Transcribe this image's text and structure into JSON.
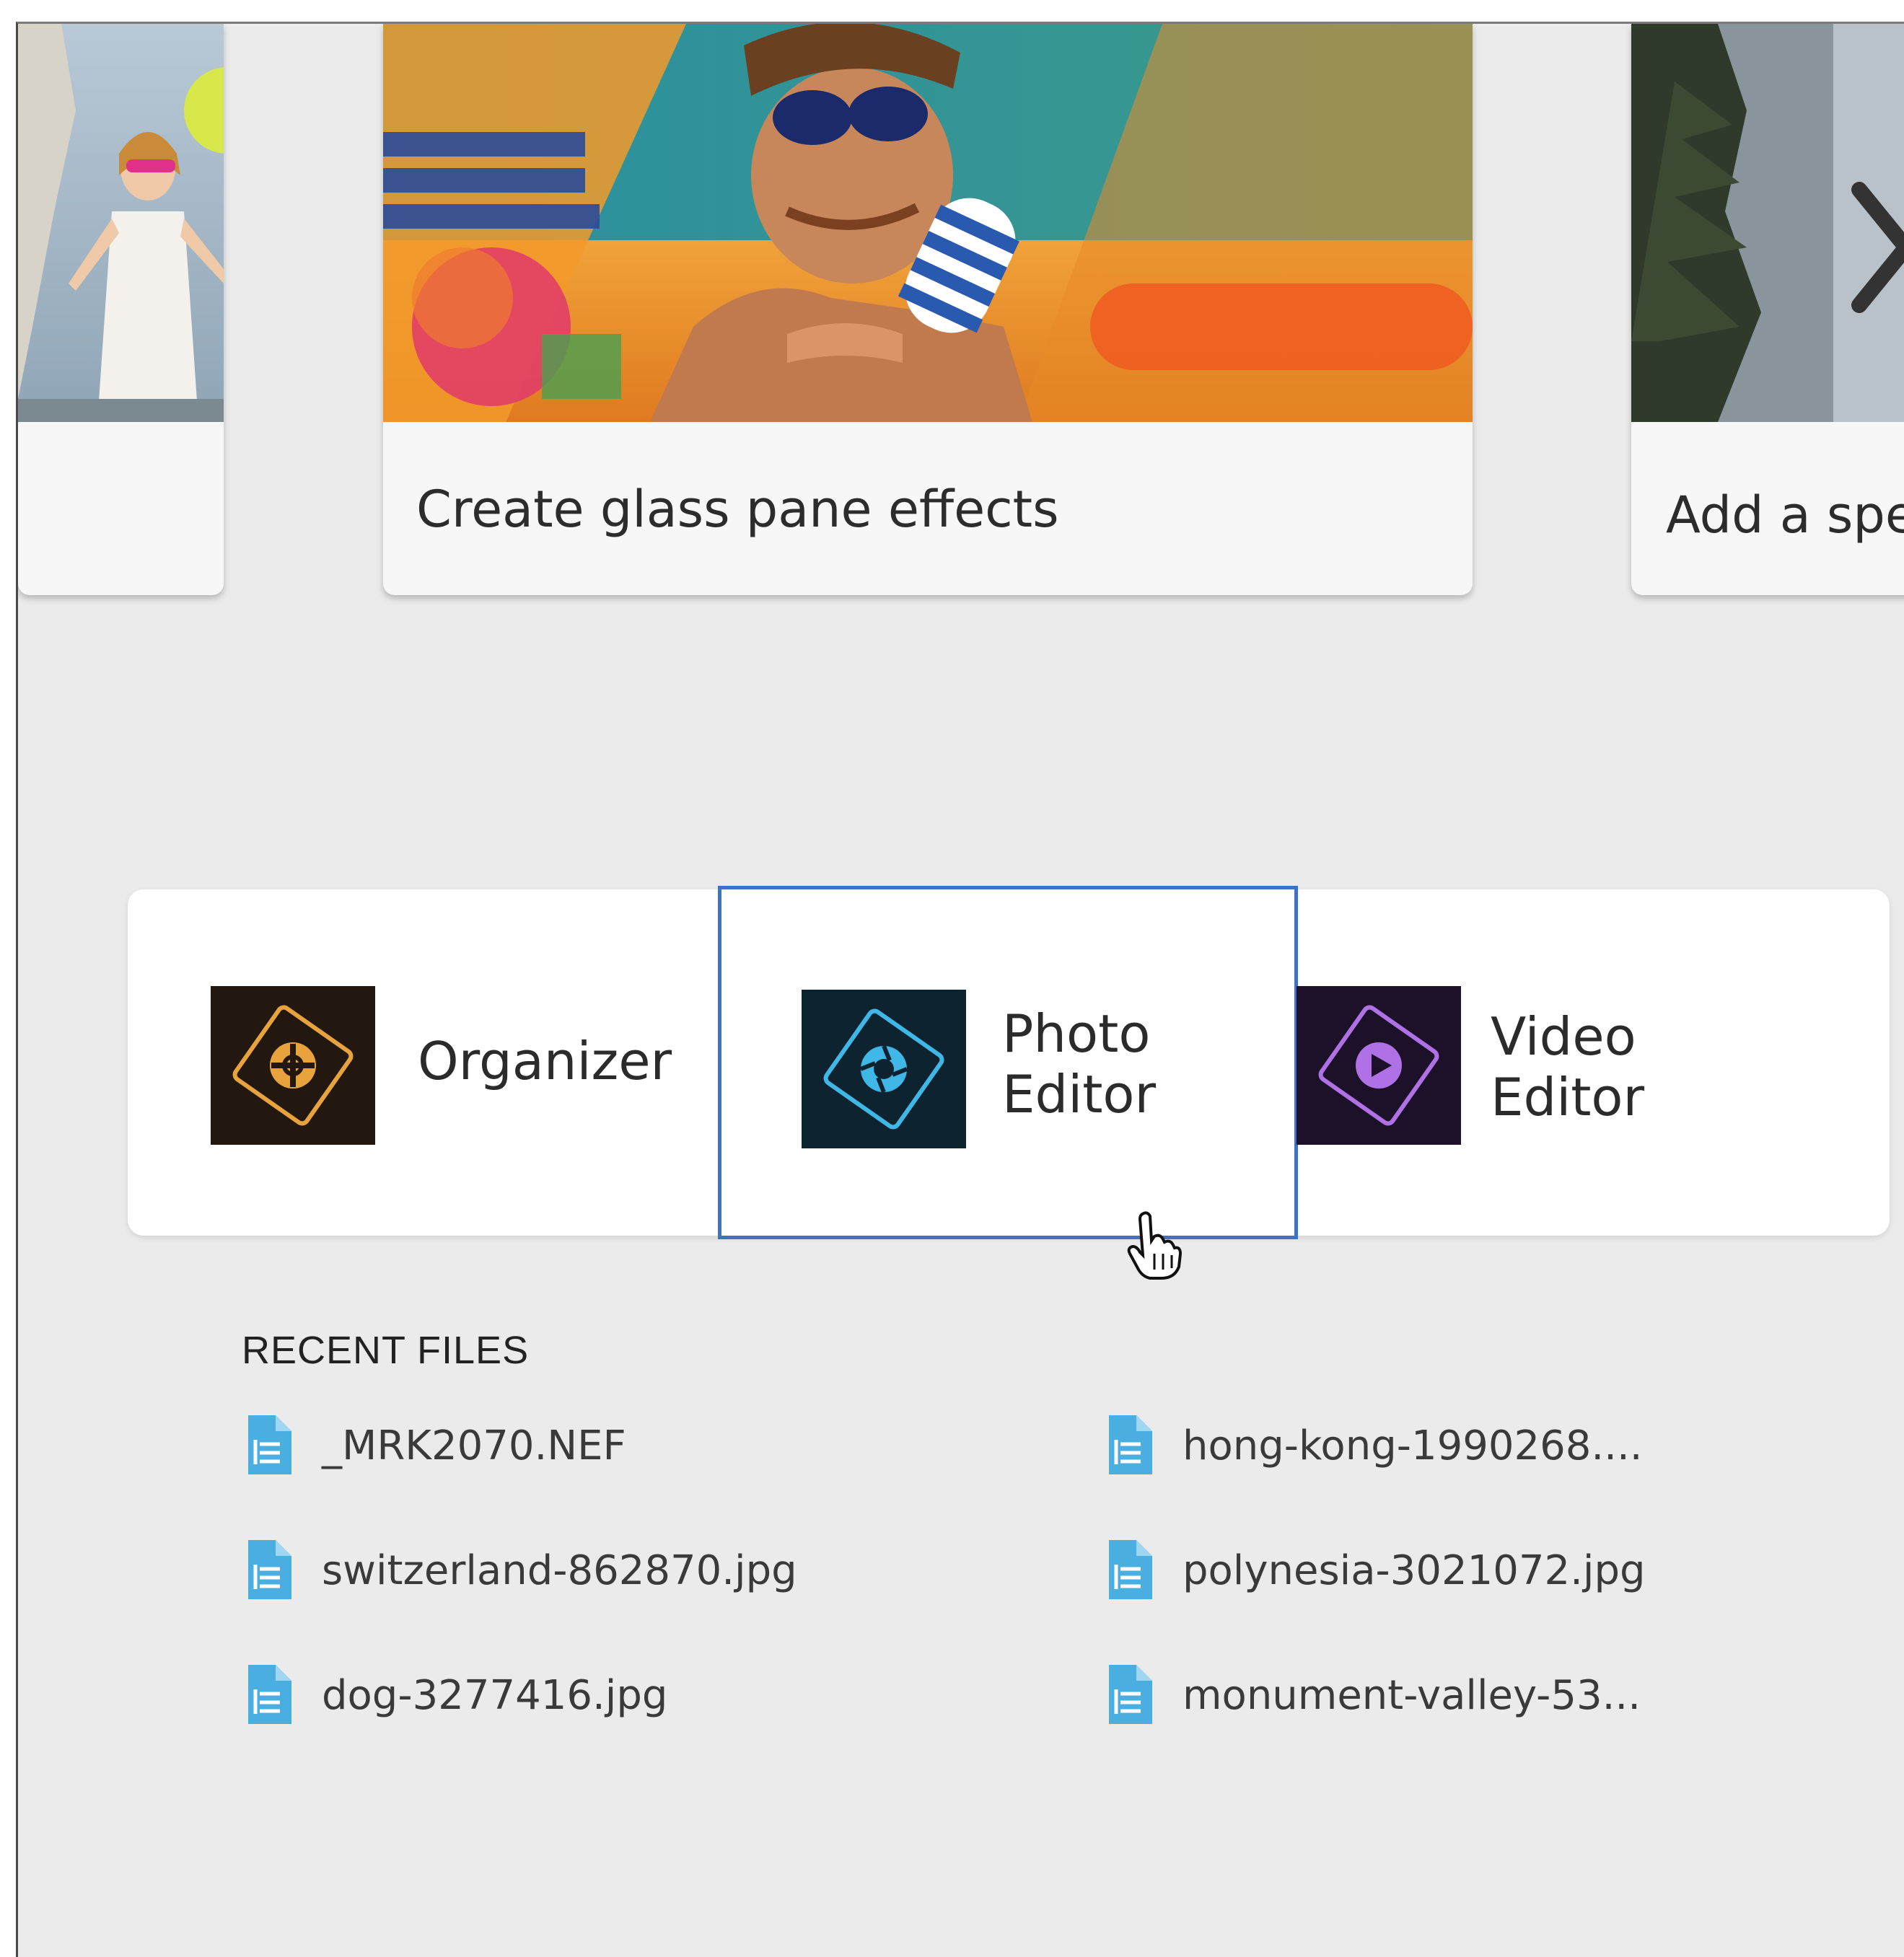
{
  "carousel": {
    "cards": [
      {
        "caption": ""
      },
      {
        "caption": "Create glass pane effects"
      },
      {
        "caption": "Add a spe"
      }
    ]
  },
  "launcher": {
    "apps": [
      {
        "label_line1": "Organizer",
        "label_line2": "",
        "icon": "organizer-icon",
        "color": "#22180f",
        "accent": "#e8a33d"
      },
      {
        "label_line1": "Photo",
        "label_line2": "Editor",
        "icon": "photo-editor-icon",
        "color": "#0d2430",
        "accent": "#3fb8e8",
        "selected": true
      },
      {
        "label_line1": "Video",
        "label_line2": "Editor",
        "icon": "video-editor-icon",
        "color": "#1d1129",
        "accent": "#b070e6"
      }
    ]
  },
  "recent_files": {
    "title": "RECENT FILES",
    "files": [
      "_MRK2070.NEF",
      "hong-kong-1990268....",
      "switzerland-862870.jpg",
      "polynesia-3021072.jpg",
      "dog-3277416.jpg",
      "monument-valley-53..."
    ]
  },
  "colors": {
    "background": "#ebebeb",
    "selection_border": "#3d73c4",
    "file_icon": "#4aaee0"
  }
}
